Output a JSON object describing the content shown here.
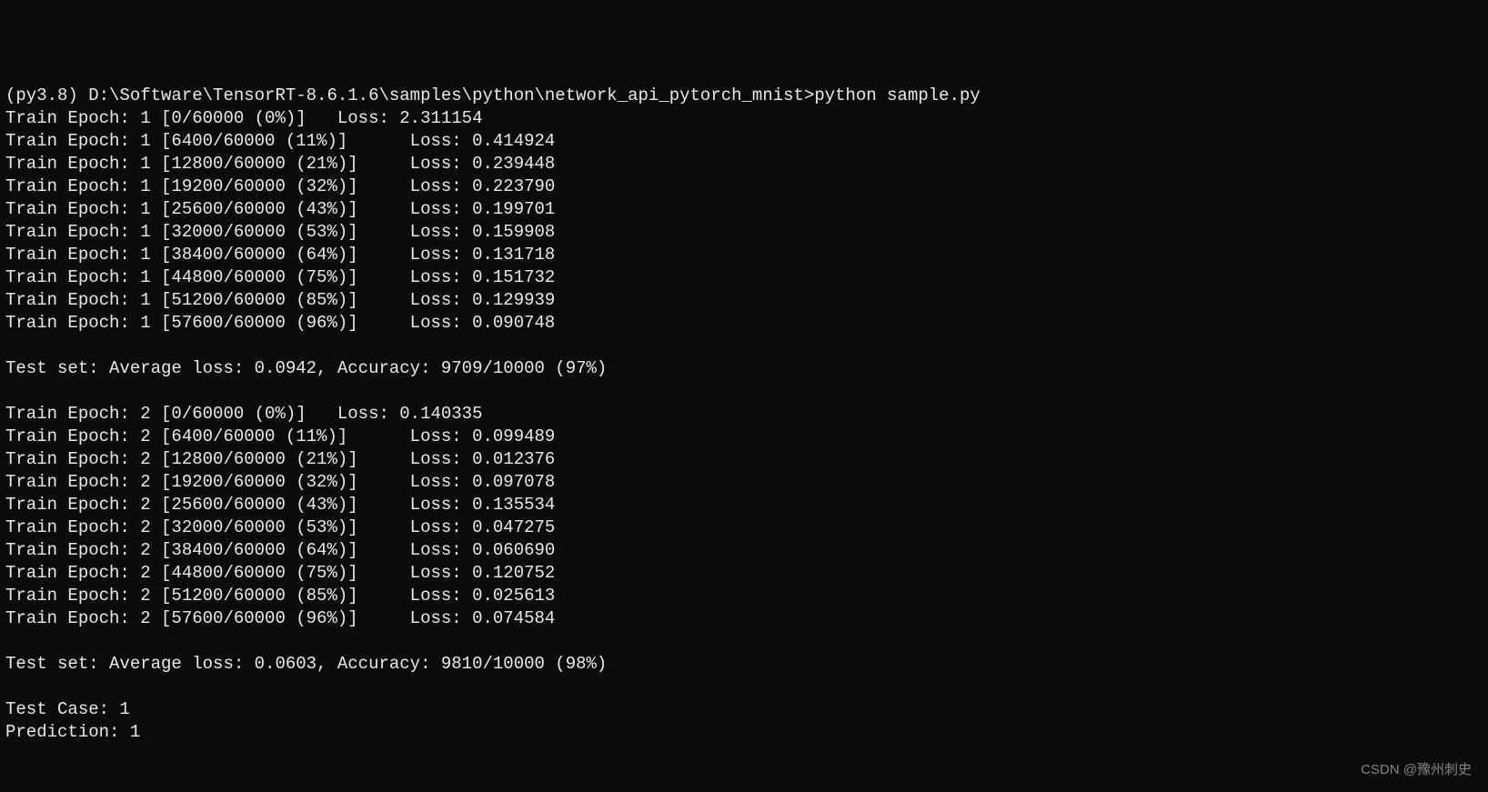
{
  "prompt": "(py3.8) D:\\Software\\TensorRT-8.6.1.6\\samples\\python\\network_api_pytorch_mnist>python sample.py",
  "epoch1": {
    "lines": [
      "Train Epoch: 1 [0/60000 (0%)]   Loss: 2.311154",
      "Train Epoch: 1 [6400/60000 (11%)]      Loss: 0.414924",
      "Train Epoch: 1 [12800/60000 (21%)]     Loss: 0.239448",
      "Train Epoch: 1 [19200/60000 (32%)]     Loss: 0.223790",
      "Train Epoch: 1 [25600/60000 (43%)]     Loss: 0.199701",
      "Train Epoch: 1 [32000/60000 (53%)]     Loss: 0.159908",
      "Train Epoch: 1 [38400/60000 (64%)]     Loss: 0.131718",
      "Train Epoch: 1 [44800/60000 (75%)]     Loss: 0.151732",
      "Train Epoch: 1 [51200/60000 (85%)]     Loss: 0.129939",
      "Train Epoch: 1 [57600/60000 (96%)]     Loss: 0.090748"
    ],
    "test": "Test set: Average loss: 0.0942, Accuracy: 9709/10000 (97%)"
  },
  "epoch2": {
    "lines": [
      "Train Epoch: 2 [0/60000 (0%)]   Loss: 0.140335",
      "Train Epoch: 2 [6400/60000 (11%)]      Loss: 0.099489",
      "Train Epoch: 2 [12800/60000 (21%)]     Loss: 0.012376",
      "Train Epoch: 2 [19200/60000 (32%)]     Loss: 0.097078",
      "Train Epoch: 2 [25600/60000 (43%)]     Loss: 0.135534",
      "Train Epoch: 2 [32000/60000 (53%)]     Loss: 0.047275",
      "Train Epoch: 2 [38400/60000 (64%)]     Loss: 0.060690",
      "Train Epoch: 2 [44800/60000 (75%)]     Loss: 0.120752",
      "Train Epoch: 2 [51200/60000 (85%)]     Loss: 0.025613",
      "Train Epoch: 2 [57600/60000 (96%)]     Loss: 0.074584"
    ],
    "test": "Test set: Average loss: 0.0603, Accuracy: 9810/10000 (98%)"
  },
  "result": {
    "test_case": "Test Case: 1",
    "prediction": "Prediction: 1"
  },
  "watermark": "CSDN @豫州刺史"
}
